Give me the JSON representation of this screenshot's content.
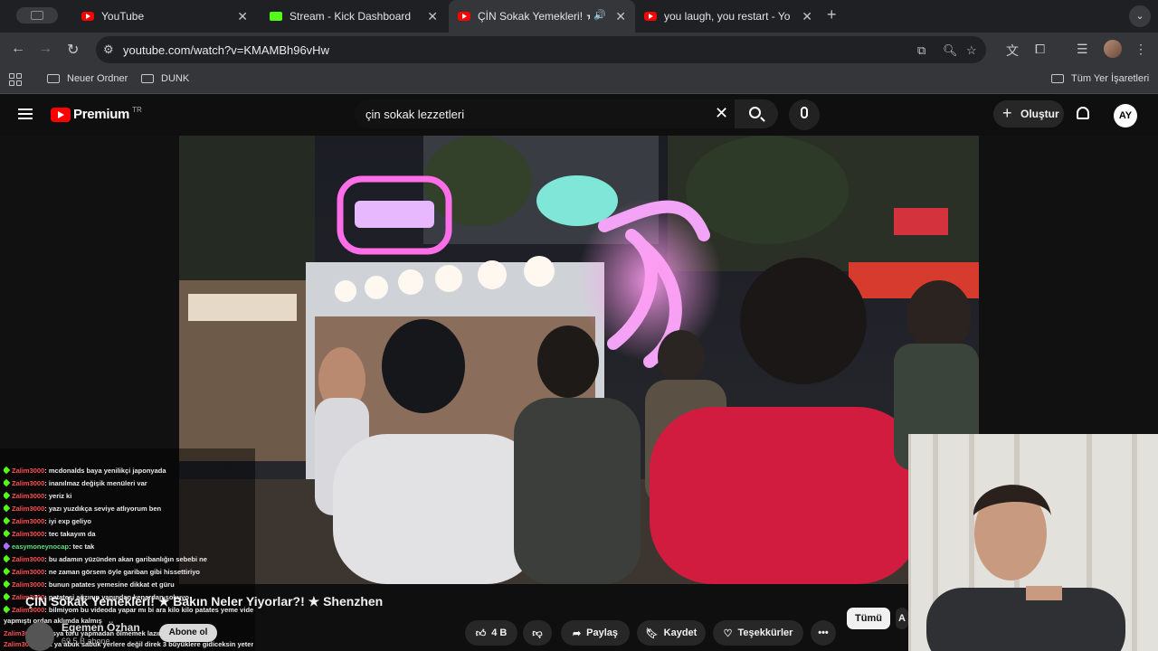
{
  "browser": {
    "tabs": [
      {
        "title": "YouTube",
        "favicon": "youtube-icon"
      },
      {
        "title": "Stream - Kick Dashboard",
        "favicon": "kick-icon"
      },
      {
        "title": "ÇİN Sokak Yemekleri! ★ B",
        "favicon": "youtube-icon",
        "audio": true
      },
      {
        "title": "you laugh, you restart - YouTu",
        "favicon": "youtube-icon"
      }
    ],
    "new_tab": "+",
    "url": "youtube.com/watch?v=KMAMBh96vHw",
    "bookmarks": [
      "Neuer Ordner",
      "DUNK"
    ],
    "all_bookmarks": "Tüm Yer İşaretleri"
  },
  "youtube": {
    "logo": "Premium",
    "region": "TR",
    "search_query": "çin sokak lezzetleri",
    "create_label": "Oluştur",
    "avatar_initials": "AY"
  },
  "chat": [
    {
      "user": "Zalim3000",
      "msg": ": mcdonalds baya yenilikçi japonyada"
    },
    {
      "user": "Zalim3000",
      "msg": ": inanılmaz değişik menüleri var"
    },
    {
      "user": "Zalim3000",
      "msg": ": yeriz ki"
    },
    {
      "user": "Zalim3000",
      "msg": ": yazı yuzdıkça seviye atlıyorum ben"
    },
    {
      "user": "Zalim3000",
      "msg": ": iyi exp geliyo"
    },
    {
      "user": "Zalim3000",
      "msg": ": tec takayım da"
    },
    {
      "user": "easymoneynocap",
      "msg": ": tec tak"
    },
    {
      "user": "Zalim3000",
      "msg": ": bu adamın yüzünden akan garibanlığın sebebi ne"
    },
    {
      "user": "Zalim3000",
      "msg": ": ne zaman görsem öyle gariban gibi hissettiriyo"
    },
    {
      "user": "Zalim3000",
      "msg": ": bunun patates yemesine dikkat et güru"
    },
    {
      "user": "Zalim3000",
      "msg": ": patatesi ağzının yanından kenardan sokuyo"
    },
    {
      "user": "Zalim3000",
      "msg": ": bilmiyom bu videoda yapar mı bi ara kilo kilo patates yeme videosu"
    },
    {
      "user": "",
      "msg": "yapmıştı ordan aklımda kalmış"
    },
    {
      "user": "Zalim3000",
      "msg": ": bi asya turu yapmadan ölmemek lazım ya"
    },
    {
      "user": "Zalim3000",
      "msg": ": yok ya abuk sabuk yerlere değil direk 3 büyüklere gidiceksin yeter"
    }
  ],
  "video": {
    "title": "ÇİN Sokak Yemekleri! ★ Bakın Neler Yiyorlar?! ★ Shenzhen",
    "channel": "Egemen Özhan",
    "subscribers": "69,5 B abone",
    "subscribe_label": "Abone ol",
    "likes": "4 B",
    "share": "Paylaş",
    "save": "Kaydet",
    "thanks": "Teşekkürler",
    "more": "•••"
  },
  "filters": [
    "Tümü",
    "A"
  ],
  "colors": {
    "youtube_red": "#ff0000",
    "kick_green": "#53fc18",
    "chat_user": "#ff4d4d"
  }
}
